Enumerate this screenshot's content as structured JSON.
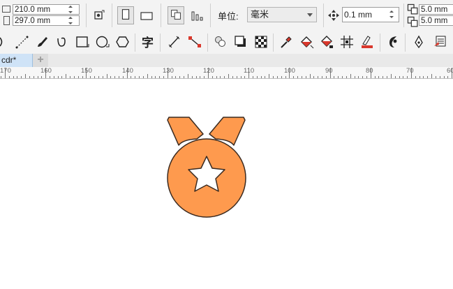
{
  "property_bar": {
    "page_width": "210.0 mm",
    "page_height": "297.0 mm",
    "units_label": "单位:",
    "units_value": "毫米",
    "nudge_value": "0.1 mm",
    "dup_x": "5.0 mm",
    "dup_y": "5.0 mm"
  },
  "document_tab": {
    "label": "cdr*",
    "add_label": "+"
  },
  "ruler": {
    "labels": [
      "170",
      "160",
      "150",
      "140",
      "130",
      "120",
      "110",
      "100",
      "90",
      "80",
      "70",
      "60"
    ]
  },
  "artwork": {
    "fill": "#FE9A4E",
    "outline": "#3A2A20",
    "star_fill": "#FFFFFF"
  },
  "colors": {
    "toolbar_bg": "#F3F3F3",
    "tab_active": "#CFE3F7",
    "accent_red": "#D9382C"
  }
}
